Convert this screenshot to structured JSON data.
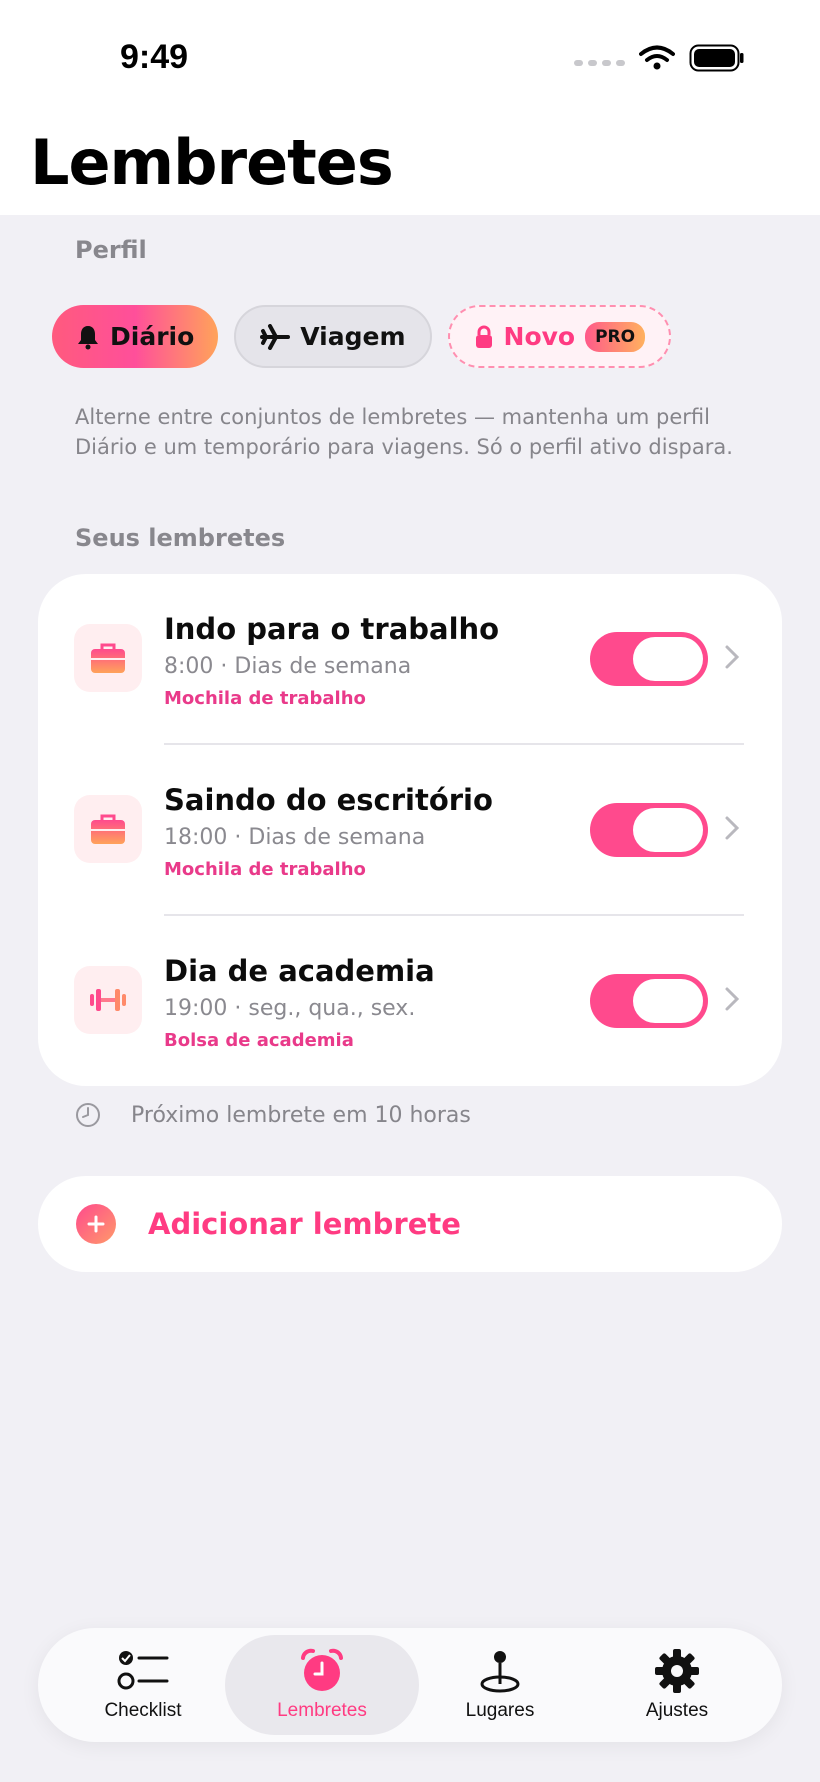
{
  "status_bar": {
    "time": "9:49"
  },
  "header": {
    "title": "Lembretes"
  },
  "profile": {
    "section_label": "Perfil",
    "chips": [
      {
        "label": "Diário",
        "icon": "bell-icon",
        "active": true
      },
      {
        "label": "Viagem",
        "icon": "airplane-icon",
        "active": false
      },
      {
        "label": "Novo",
        "icon": "lock-icon",
        "badge": "PRO",
        "active": false
      }
    ],
    "description": "Alterne entre conjuntos de lembretes — mantenha um perfil Diário e um temporário para viagens. Só o perfil ativo dispara."
  },
  "reminders": {
    "section_label": "Seus lembretes",
    "items": [
      {
        "title": "Indo para o trabalho",
        "subtitle": "8:00 · Dias de semana",
        "bag": "Mochila de trabalho",
        "icon": "briefcase-icon",
        "enabled": true
      },
      {
        "title": "Saindo do escritório",
        "subtitle": "18:00 · Dias de semana",
        "bag": "Mochila de trabalho",
        "icon": "briefcase-icon",
        "enabled": true
      },
      {
        "title": "Dia de academia",
        "subtitle": "19:00 · seg., qua., sex.",
        "bag": "Bolsa de academia",
        "icon": "dumbbell-icon",
        "enabled": true
      }
    ],
    "next_text": "Próximo lembrete em 10 horas"
  },
  "add_button": {
    "label": "Adicionar lembrete"
  },
  "tabbar": {
    "tabs": [
      {
        "label": "Checklist",
        "icon": "checklist-icon",
        "active": false
      },
      {
        "label": "Lembretes",
        "icon": "alarm-clock-icon",
        "active": true
      },
      {
        "label": "Lugares",
        "icon": "map-pin-icon",
        "active": false
      },
      {
        "label": "Ajustes",
        "icon": "gear-icon",
        "active": false
      }
    ]
  },
  "colors": {
    "accent": "#ff3b82",
    "toggle_on": "#ff4a8d",
    "background": "#f1f0f5"
  }
}
